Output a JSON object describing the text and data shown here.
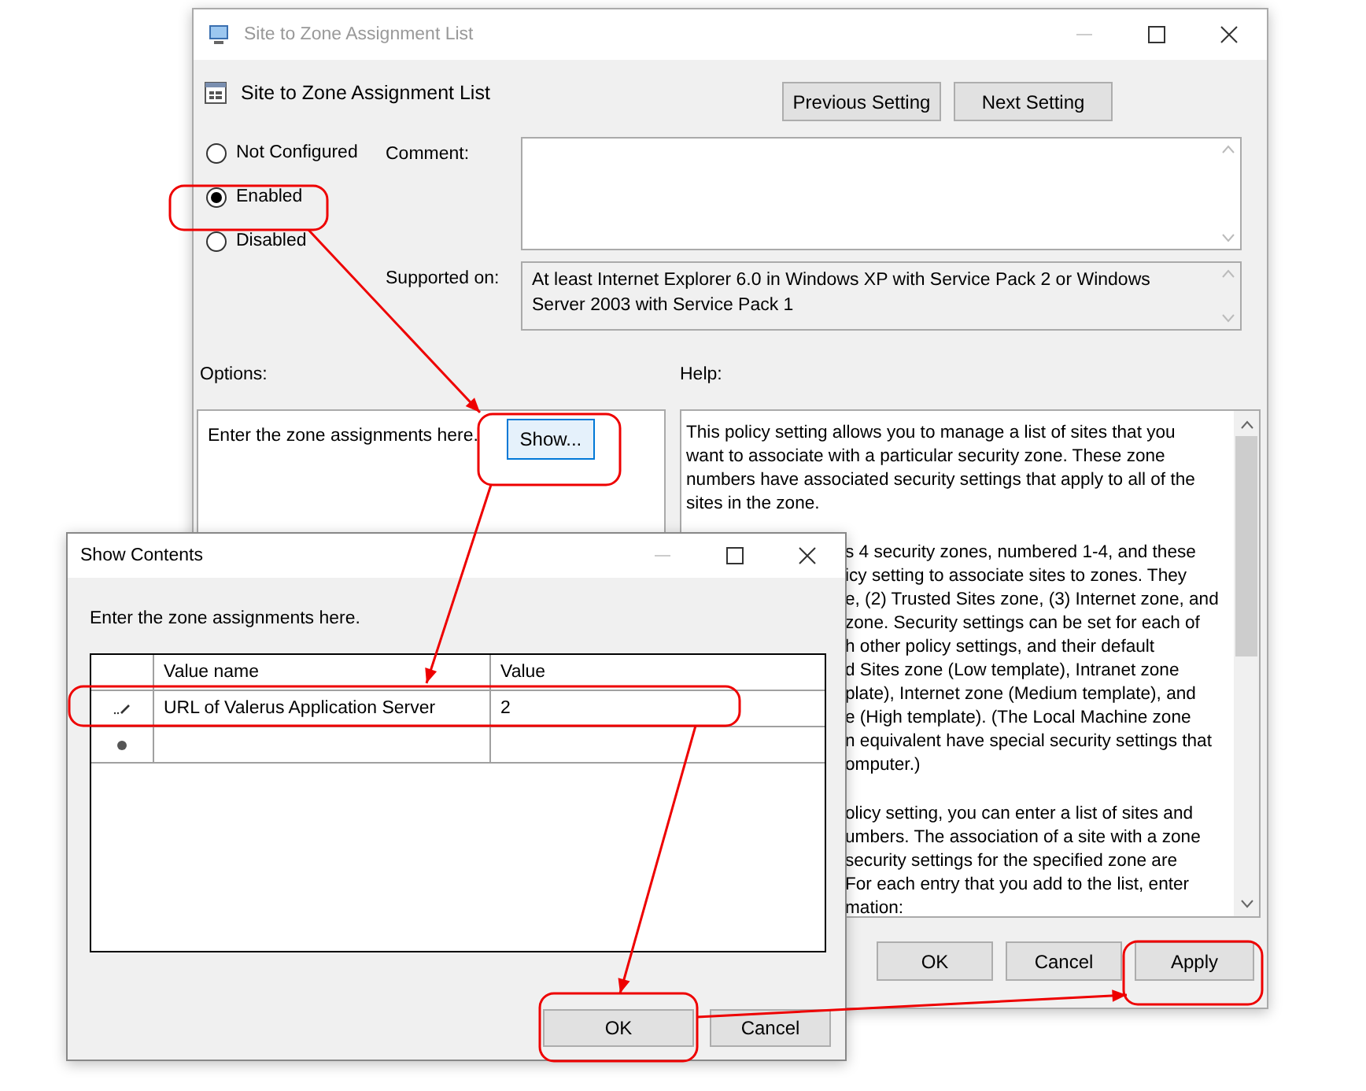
{
  "main_window": {
    "title": "Site to Zone Assignment List",
    "setting_title": "Site to Zone Assignment List",
    "nav_buttons": [
      "Previous Setting",
      "Next Setting"
    ],
    "state_options": [
      {
        "label": "Not Configured",
        "selected": false
      },
      {
        "label": "Enabled",
        "selected": true
      },
      {
        "label": "Disabled",
        "selected": false
      }
    ],
    "comment": {
      "label": "Comment:"
    },
    "supported_on": {
      "label": "Supported on:",
      "value": "At least Internet Explorer 6.0 in Windows XP with Service Pack 2 or Windows Server 2003 with Service Pack 1"
    },
    "options": {
      "label": "Options:",
      "prompt": "Enter the zone assignments here.",
      "button": "Show..."
    },
    "help": {
      "label": "Help:",
      "paragraphs": [
        {
          "partly_hidden": false,
          "lines": [
            "This policy setting allows you to manage a list of sites that you",
            "want to associate with a particular security zone. These zone",
            "numbers have associated security settings that apply to all of the",
            "sites in the zone."
          ]
        },
        {
          "partly_hidden": true,
          "lines": [
            "s 4 security zones, numbered 1-4, and these",
            "icy setting to associate sites to zones. They",
            "e, (2) Trusted Sites zone, (3) Internet zone, and",
            "zone. Security settings can be set for each of",
            "h other policy settings, and their default",
            "d Sites zone (Low template), Intranet zone",
            "plate), Internet zone (Medium template), and",
            "e (High template). (The Local Machine zone",
            "n equivalent have special security settings that",
            "omputer.)"
          ]
        },
        {
          "partly_hidden": true,
          "lines": [
            "olicy setting, you can enter a list of sites and",
            "umbers. The association of a site with a zone",
            "security settings for the specified zone are",
            "For each entry that you add to the list, enter",
            "mation:"
          ]
        }
      ]
    },
    "buttons": [
      "OK",
      "Cancel",
      "Apply"
    ]
  },
  "dialog": {
    "title": "Show Contents",
    "prompt": "Enter the zone assignments here.",
    "table": {
      "columns": [
        "Value name",
        "Value"
      ],
      "rows": [
        {
          "kind": "editing",
          "value_name": "URL of Valerus Application Server",
          "value": "2"
        },
        {
          "kind": "new"
        }
      ]
    },
    "buttons": [
      "OK",
      "Cancel"
    ]
  }
}
